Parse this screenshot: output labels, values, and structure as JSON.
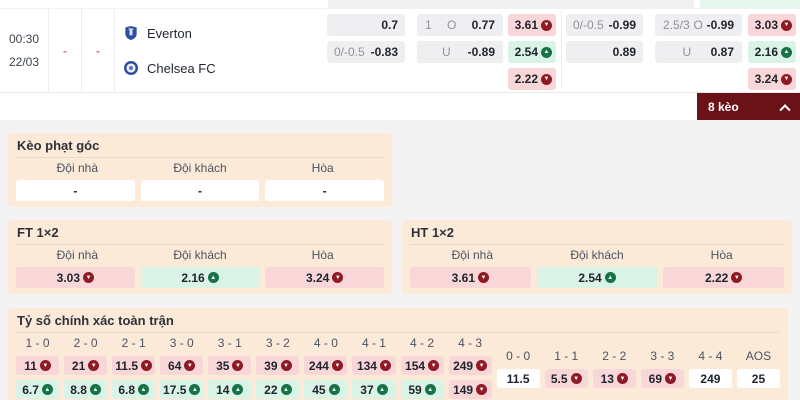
{
  "match": {
    "time": "00:30",
    "date": "22/03",
    "dash1": "-",
    "dash2": "-",
    "home_team": "Everton",
    "away_team": "Chelsea FC"
  },
  "odds": {
    "g1": {
      "hdp": {
        "r1": {
          "line": "",
          "odds": "0.7"
        },
        "r2": {
          "line": "0/-0.5",
          "odds": "-0.83"
        }
      },
      "ou": {
        "r1": {
          "line": "1",
          "side": "O",
          "odds": "0.77"
        },
        "r2": {
          "line": "",
          "side": "U",
          "odds": "-0.89"
        }
      },
      "x12": {
        "r1": {
          "value": "3.61",
          "trend": "down"
        },
        "r2": {
          "value": "2.54",
          "trend": "up"
        },
        "r3": {
          "value": "2.22",
          "trend": "down"
        }
      }
    },
    "g2": {
      "hdp": {
        "r1": {
          "line": "0/-0.5",
          "odds": "-0.99"
        },
        "r2": {
          "line": "",
          "odds": "0.89"
        }
      },
      "ou": {
        "r1": {
          "line": "2.5/3",
          "side": "O",
          "odds": "-0.99"
        },
        "r2": {
          "line": "",
          "side": "U",
          "odds": "0.87"
        }
      },
      "x12": {
        "r1": {
          "value": "3.03",
          "trend": "down"
        },
        "r2": {
          "value": "2.16",
          "trend": "up"
        },
        "r3": {
          "value": "3.24",
          "trend": "down"
        }
      }
    }
  },
  "keo_bar": {
    "label": "8 kèo"
  },
  "sections": {
    "corners": {
      "title": "Kèo phạt góc",
      "headers": [
        "Đội nhà",
        "Đội khách",
        "Hòa"
      ],
      "cells": [
        {
          "value": "-",
          "trend": "none"
        },
        {
          "value": "-",
          "trend": "none"
        },
        {
          "value": "-",
          "trend": "none"
        }
      ]
    },
    "ft": {
      "title": "FT 1×2",
      "headers": [
        "Đội nhà",
        "Đội khách",
        "Hòa"
      ],
      "cells": [
        {
          "value": "3.03",
          "trend": "down"
        },
        {
          "value": "2.16",
          "trend": "up"
        },
        {
          "value": "3.24",
          "trend": "down"
        }
      ]
    },
    "ht": {
      "title": "HT 1×2",
      "headers": [
        "Đội nhà",
        "Đội khách",
        "Hòa"
      ],
      "cells": [
        {
          "value": "3.61",
          "trend": "down"
        },
        {
          "value": "2.54",
          "trend": "up"
        },
        {
          "value": "2.22",
          "trend": "down"
        }
      ]
    },
    "correct_score": {
      "title": "Tỷ số chính xác toàn trận",
      "scores": [
        {
          "label": "1 - 0",
          "top": {
            "value": "11",
            "trend": "down"
          },
          "bottom": {
            "value": "6.7",
            "trend": "up"
          }
        },
        {
          "label": "2 - 0",
          "top": {
            "value": "21",
            "trend": "down"
          },
          "bottom": {
            "value": "8.8",
            "trend": "up"
          }
        },
        {
          "label": "2 - 1",
          "top": {
            "value": "11.5",
            "trend": "down"
          },
          "bottom": {
            "value": "6.8",
            "trend": "up"
          }
        },
        {
          "label": "3 - 0",
          "top": {
            "value": "64",
            "trend": "down"
          },
          "bottom": {
            "value": "17.5",
            "trend": "up"
          }
        },
        {
          "label": "3 - 1",
          "top": {
            "value": "35",
            "trend": "down"
          },
          "bottom": {
            "value": "14",
            "trend": "up"
          }
        },
        {
          "label": "3 - 2",
          "top": {
            "value": "39",
            "trend": "down"
          },
          "bottom": {
            "value": "22",
            "trend": "up"
          }
        },
        {
          "label": "4 - 0",
          "top": {
            "value": "244",
            "trend": "down"
          },
          "bottom": {
            "value": "45",
            "trend": "up"
          }
        },
        {
          "label": "4 - 1",
          "top": {
            "value": "134",
            "trend": "down"
          },
          "bottom": {
            "value": "37",
            "trend": "up"
          }
        },
        {
          "label": "4 - 2",
          "top": {
            "value": "154",
            "trend": "down"
          },
          "bottom": {
            "value": "59",
            "trend": "up"
          }
        },
        {
          "label": "4 - 3",
          "top": {
            "value": "249",
            "trend": "down"
          },
          "bottom": {
            "value": "149",
            "trend": "down"
          }
        }
      ],
      "draws": [
        {
          "label": "0 - 0",
          "value": "11.5",
          "trend": "none"
        },
        {
          "label": "1 - 1",
          "value": "5.5",
          "trend": "down"
        },
        {
          "label": "2 - 2",
          "value": "13",
          "trend": "down"
        },
        {
          "label": "3 - 3",
          "value": "69",
          "trend": "down"
        },
        {
          "label": "4 - 4",
          "value": "249",
          "trend": "none"
        },
        {
          "label": "AOS",
          "value": "25",
          "trend": "none"
        }
      ]
    }
  },
  "colors": {
    "accent_maroon": "#6b1118",
    "panel_peach": "#fcead9",
    "odds_pink": "#f9d7d9",
    "odds_green": "#d9f3e6",
    "odds_gray": "#efeff1",
    "icon_down_red": "#8e1a24",
    "icon_up_green": "#157347",
    "dash_red": "#e4757d"
  }
}
